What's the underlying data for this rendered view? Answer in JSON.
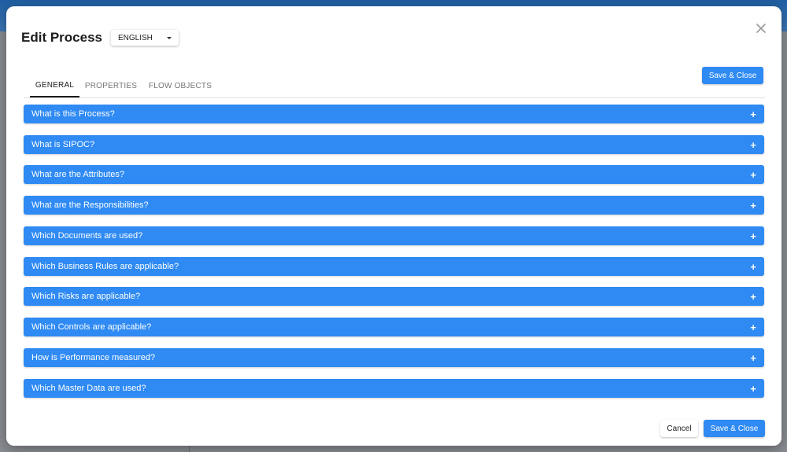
{
  "dialog": {
    "title": "Edit Process",
    "language": "ENGLISH",
    "save_close_label": "Save & Close",
    "cancel_label": "Cancel"
  },
  "tabs": [
    {
      "label": "GENERAL",
      "active": true
    },
    {
      "label": "PROPERTIES",
      "active": false
    },
    {
      "label": "FLOW OBJECTS",
      "active": false
    }
  ],
  "panels": [
    {
      "label": "What is this Process?",
      "icon": "+"
    },
    {
      "label": "What is SIPOC?",
      "icon": "+"
    },
    {
      "label": "What are the Attributes?",
      "icon": "+"
    },
    {
      "label": "What are the Responsibilities?",
      "icon": "+"
    },
    {
      "label": "Which Documents are used?",
      "icon": "+"
    },
    {
      "label": "Which Business Rules are applicable?",
      "icon": "+"
    },
    {
      "label": "Which Risks are applicable?",
      "icon": "+"
    },
    {
      "label": "Which Controls are applicable?",
      "icon": "+"
    },
    {
      "label": "How is Performance measured?",
      "icon": "+"
    },
    {
      "label": "Which Master Data are used?",
      "icon": "+"
    }
  ],
  "colors": {
    "accent": "#2f8af3",
    "backdrop_header": "#1f5fa3"
  }
}
